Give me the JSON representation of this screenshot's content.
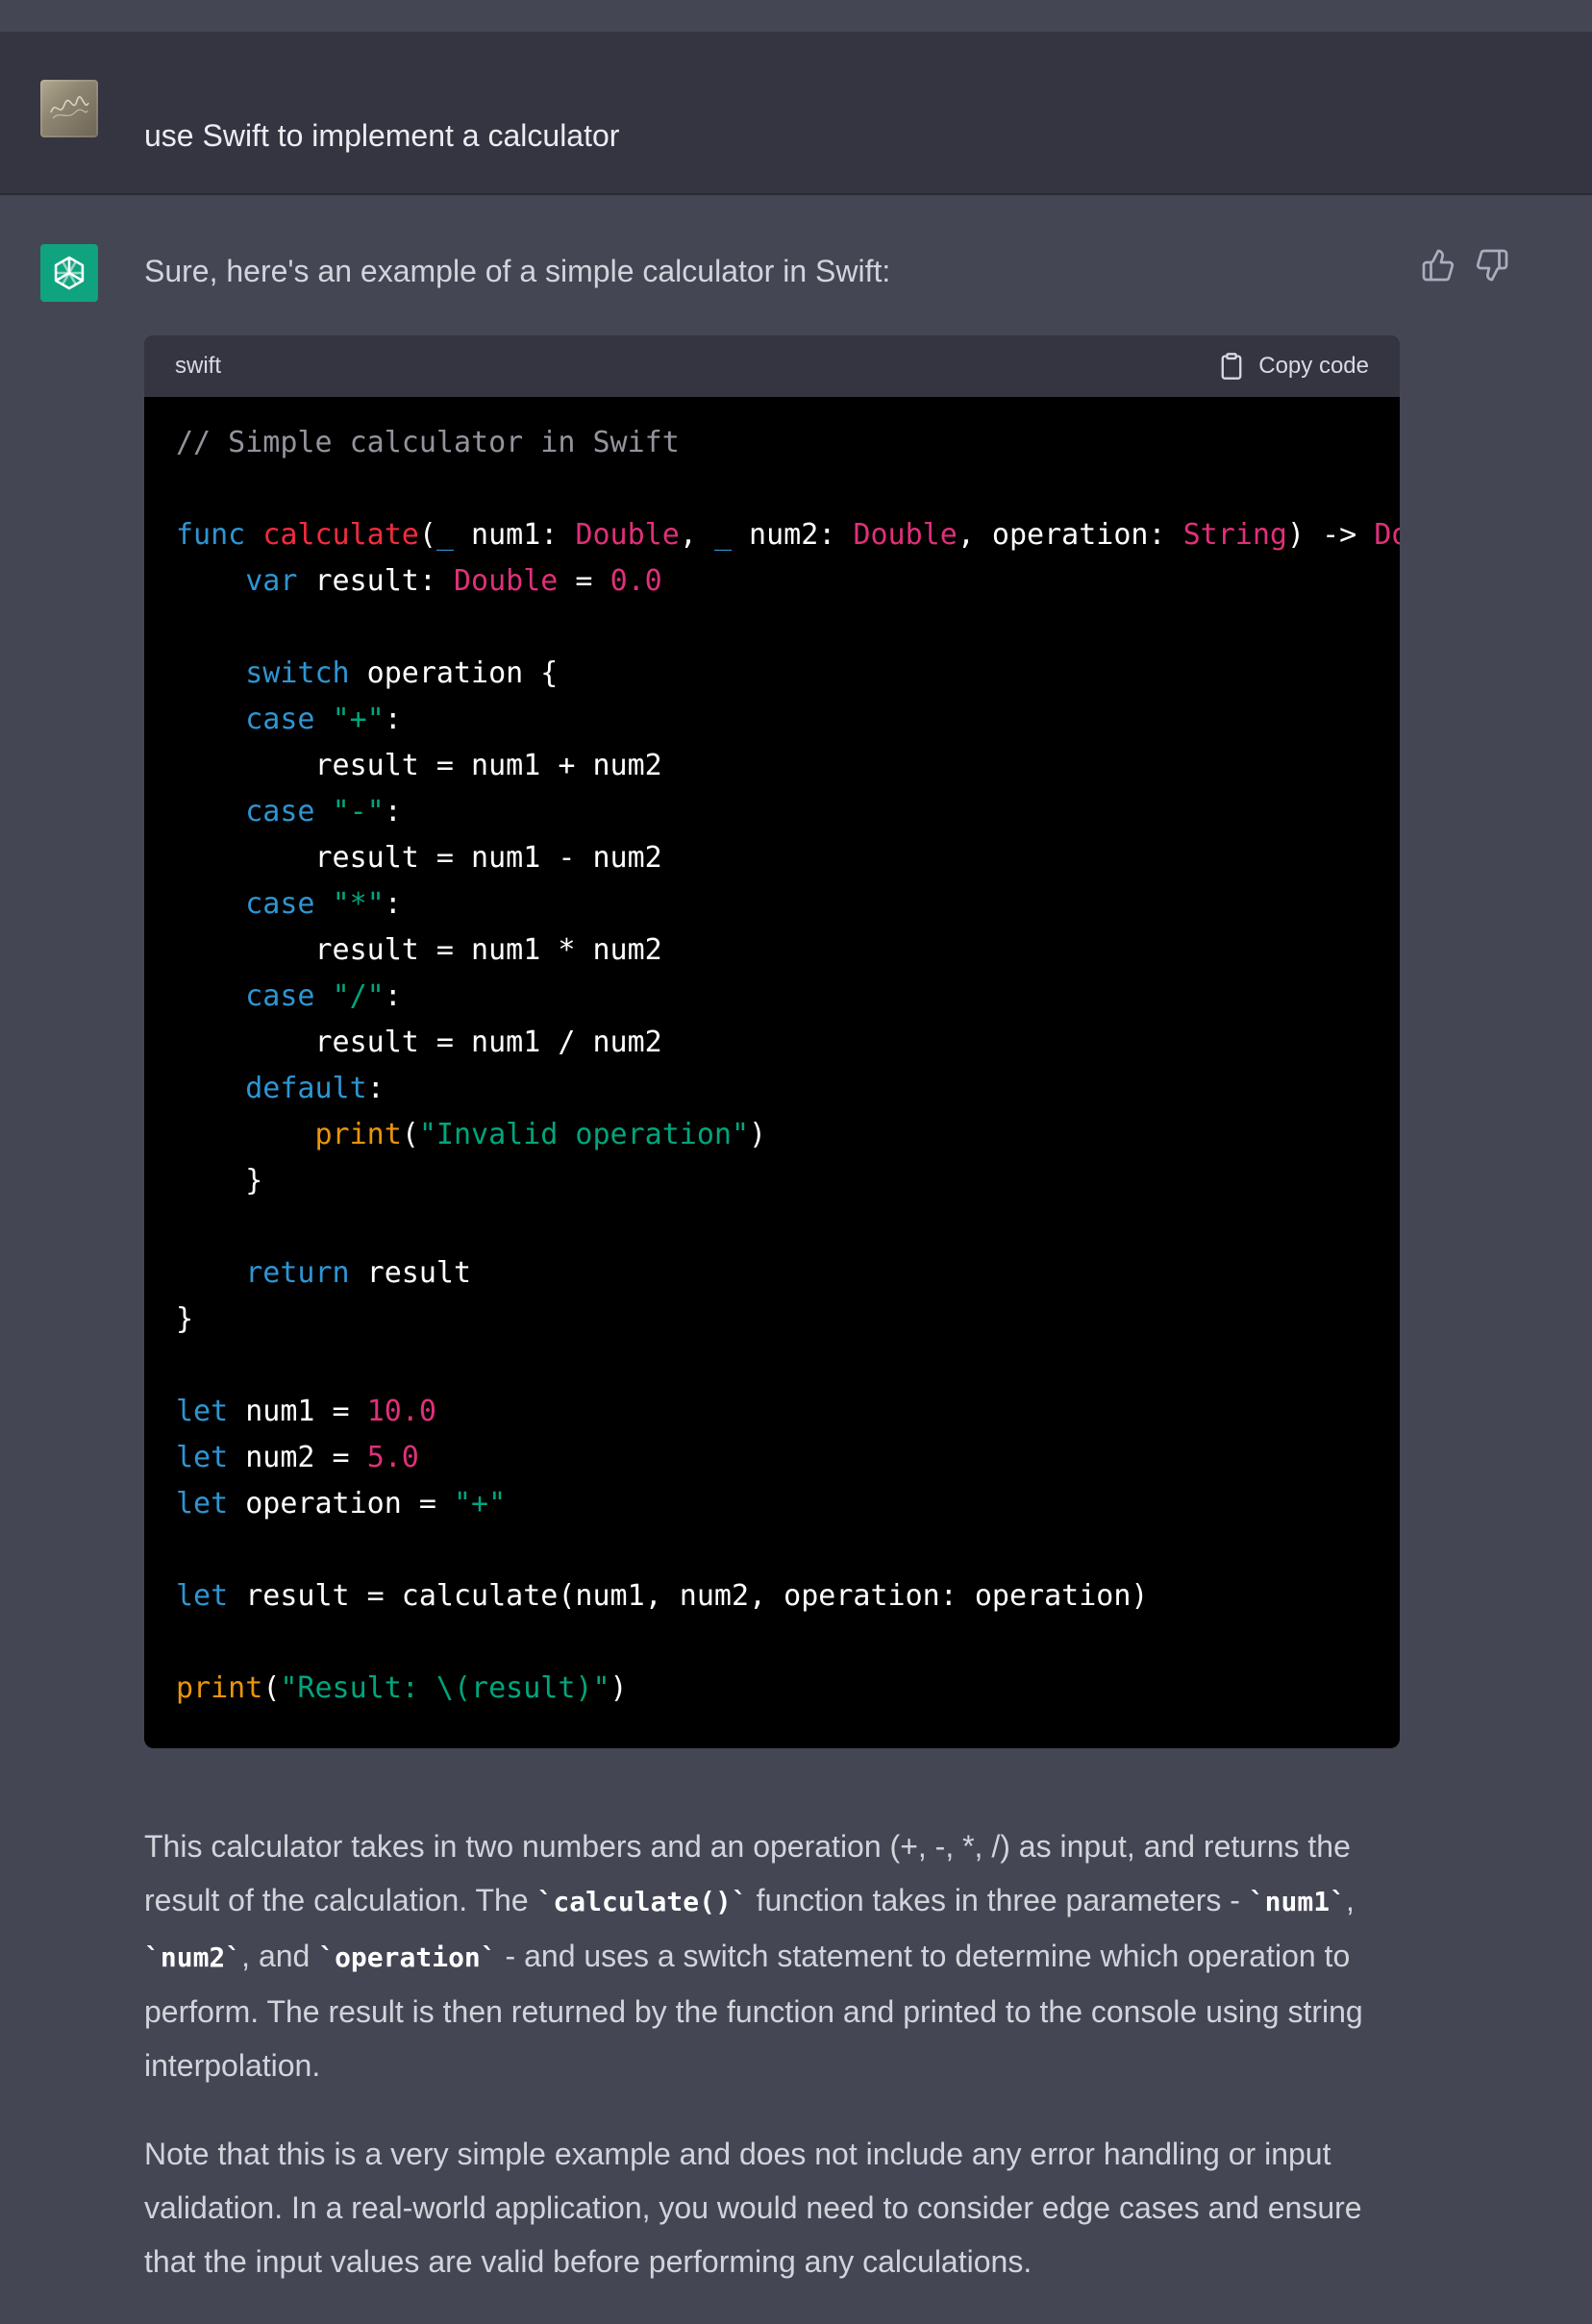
{
  "user_message": {
    "text": "use Swift to implement a calculator",
    "avatar": "user-avatar"
  },
  "assistant_message": {
    "intro": "Sure, here's an example of a simple calculator in Swift:",
    "feedback": {
      "thumbs_up_icon": "thumbs-up-icon",
      "thumbs_down_icon": "thumbs-down-icon"
    },
    "code_block": {
      "language": "swift",
      "copy_label": "Copy code",
      "lines": [
        [
          {
            "t": "// Simple calculator in Swift",
            "c": "cm"
          }
        ],
        [],
        [
          {
            "t": "func",
            "c": "kw"
          },
          {
            "t": " ",
            "c": "pl"
          },
          {
            "t": "calculate",
            "c": "fn"
          },
          {
            "t": "(",
            "c": "pl"
          },
          {
            "t": "_",
            "c": "kw"
          },
          {
            "t": " num1: ",
            "c": "pl"
          },
          {
            "t": "Double",
            "c": "type"
          },
          {
            "t": ", ",
            "c": "pl"
          },
          {
            "t": "_",
            "c": "kw"
          },
          {
            "t": " num2: ",
            "c": "pl"
          },
          {
            "t": "Double",
            "c": "type"
          },
          {
            "t": ", operation: ",
            "c": "pl"
          },
          {
            "t": "String",
            "c": "type"
          },
          {
            "t": ") -> ",
            "c": "pl"
          },
          {
            "t": "Double",
            "c": "type"
          }
        ],
        [
          {
            "t": "    ",
            "c": "pl"
          },
          {
            "t": "var",
            "c": "kw"
          },
          {
            "t": " result: ",
            "c": "pl"
          },
          {
            "t": "Double",
            "c": "type"
          },
          {
            "t": " = ",
            "c": "pl"
          },
          {
            "t": "0.0",
            "c": "num"
          }
        ],
        [],
        [
          {
            "t": "    ",
            "c": "pl"
          },
          {
            "t": "switch",
            "c": "kw"
          },
          {
            "t": " operation {",
            "c": "pl"
          }
        ],
        [
          {
            "t": "    ",
            "c": "pl"
          },
          {
            "t": "case",
            "c": "kw"
          },
          {
            "t": " ",
            "c": "pl"
          },
          {
            "t": "\"+\"",
            "c": "str"
          },
          {
            "t": ":",
            "c": "pl"
          }
        ],
        [
          {
            "t": "        result = num1 + num2",
            "c": "pl"
          }
        ],
        [
          {
            "t": "    ",
            "c": "pl"
          },
          {
            "t": "case",
            "c": "kw"
          },
          {
            "t": " ",
            "c": "pl"
          },
          {
            "t": "\"-\"",
            "c": "str"
          },
          {
            "t": ":",
            "c": "pl"
          }
        ],
        [
          {
            "t": "        result = num1 - num2",
            "c": "pl"
          }
        ],
        [
          {
            "t": "    ",
            "c": "pl"
          },
          {
            "t": "case",
            "c": "kw"
          },
          {
            "t": " ",
            "c": "pl"
          },
          {
            "t": "\"*\"",
            "c": "str"
          },
          {
            "t": ":",
            "c": "pl"
          }
        ],
        [
          {
            "t": "        result = num1 * num2",
            "c": "pl"
          }
        ],
        [
          {
            "t": "    ",
            "c": "pl"
          },
          {
            "t": "case",
            "c": "kw"
          },
          {
            "t": " ",
            "c": "pl"
          },
          {
            "t": "\"/\"",
            "c": "str"
          },
          {
            "t": ":",
            "c": "pl"
          }
        ],
        [
          {
            "t": "        result = num1 / num2",
            "c": "pl"
          }
        ],
        [
          {
            "t": "    ",
            "c": "pl"
          },
          {
            "t": "default",
            "c": "kw"
          },
          {
            "t": ":",
            "c": "pl"
          }
        ],
        [
          {
            "t": "        ",
            "c": "pl"
          },
          {
            "t": "print",
            "c": "bi"
          },
          {
            "t": "(",
            "c": "pl"
          },
          {
            "t": "\"Invalid operation\"",
            "c": "str"
          },
          {
            "t": ")",
            "c": "pl"
          }
        ],
        [
          {
            "t": "    }",
            "c": "pl"
          }
        ],
        [],
        [
          {
            "t": "    ",
            "c": "pl"
          },
          {
            "t": "return",
            "c": "kw"
          },
          {
            "t": " result",
            "c": "pl"
          }
        ],
        [
          {
            "t": "}",
            "c": "pl"
          }
        ],
        [],
        [
          {
            "t": "let",
            "c": "kw"
          },
          {
            "t": " num1 = ",
            "c": "pl"
          },
          {
            "t": "10.0",
            "c": "num"
          }
        ],
        [
          {
            "t": "let",
            "c": "kw"
          },
          {
            "t": " num2 = ",
            "c": "pl"
          },
          {
            "t": "5.0",
            "c": "num"
          }
        ],
        [
          {
            "t": "let",
            "c": "kw"
          },
          {
            "t": " operation = ",
            "c": "pl"
          },
          {
            "t": "\"+\"",
            "c": "str"
          }
        ],
        [],
        [
          {
            "t": "let",
            "c": "kw"
          },
          {
            "t": " result = calculate(num1, num2, operation: operation)",
            "c": "pl"
          }
        ],
        [],
        [
          {
            "t": "print",
            "c": "bi"
          },
          {
            "t": "(",
            "c": "pl"
          },
          {
            "t": "\"Result: \\(result)\"",
            "c": "str"
          },
          {
            "t": ")",
            "c": "pl"
          }
        ]
      ]
    },
    "paragraphs": [
      [
        {
          "t": "This calculator takes in two numbers and an operation (+, -, *, /) as input, and returns the result of the calculation. The "
        },
        {
          "t": "`calculate()`",
          "code": true
        },
        {
          "t": " function takes in three parameters - "
        },
        {
          "t": "`num1`",
          "code": true
        },
        {
          "t": ", "
        },
        {
          "t": "`num2`",
          "code": true
        },
        {
          "t": ", and "
        },
        {
          "t": "`operation`",
          "code": true
        },
        {
          "t": " - and uses a switch statement to determine which operation to perform. The result is then returned by the function and printed to the console using string interpolation."
        }
      ],
      [
        {
          "t": "Note that this is a very simple example and does not include any error handling or input validation. In a real-world application, you would need to consider edge cases and ensure that the input values are valid before performing any calculations."
        }
      ]
    ]
  },
  "colors": {
    "background": "#444654",
    "user_row": "#343541",
    "code_bg": "#000000",
    "code_header": "#343541",
    "keyword": "#2e95d3",
    "type": "#df3079",
    "function_name": "#f22c3d",
    "string": "#00a67d",
    "builtin": "#e9950c",
    "assistant_avatar": "#10a37f"
  }
}
